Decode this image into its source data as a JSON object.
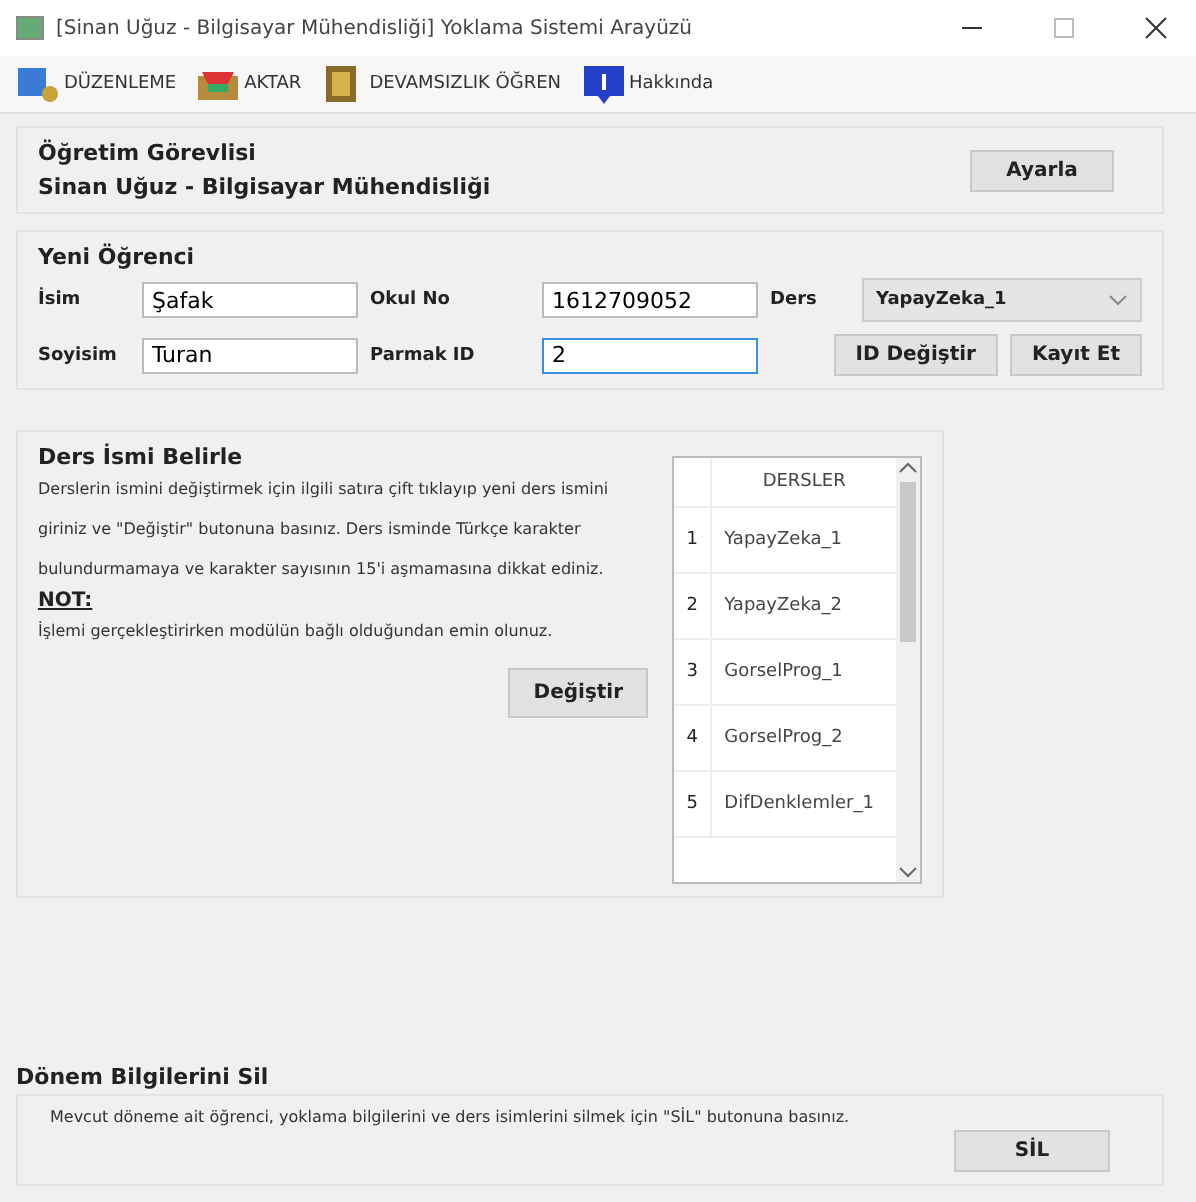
{
  "window": {
    "title": "[Sinan Uğuz - Bilgisayar Mühendisliği] Yoklama Sistemi Arayüzü"
  },
  "toolbar": [
    {
      "label": "DÜZENLEME",
      "kind": "edit"
    },
    {
      "label": "AKTAR",
      "kind": "transfer"
    },
    {
      "label": "DEVAMSIZLIK ÖĞREN",
      "kind": "learn"
    },
    {
      "label": "Hakkında",
      "kind": "about"
    }
  ],
  "instructor": {
    "heading": "Öğretim Görevlisi",
    "name": "Sinan Uğuz - Bilgisayar Mühendisliği",
    "button": "Ayarla"
  },
  "new_student": {
    "heading": "Yeni Öğrenci",
    "fields": [
      {
        "label": "İsim",
        "value": "Şafak",
        "focused": false
      },
      {
        "label": "Okul No",
        "value": "1612709052",
        "focused": false
      },
      {
        "label": "Soyisim",
        "value": "Turan",
        "focused": false
      },
      {
        "label": "Parmak ID",
        "value": "2",
        "focused": true
      }
    ],
    "course": {
      "label": "Ders",
      "value": "YapayZeka_1"
    },
    "buttons": [
      "ID Değiştir",
      "Kayıt Et"
    ]
  },
  "course_names": {
    "heading": "Ders İsmi Belirle",
    "description": "Derslerin ismini değiştirmek için ilgili satıra çift tıklayıp yeni ders ismini giriniz ve \"Değiştir\" butonuna basınız. Ders isminde Türkçe karakter bulundurmamaya ve karakter sayısının 15'i aşmamasına dikkat ediniz.",
    "note_heading": "NOT:",
    "note": "İşlemi gerçekleştirirken modülün bağlı olduğundan emin olunuz.",
    "button": "Değiştir",
    "table": {
      "columns": [
        "DERSLER"
      ],
      "rows": [
        {
          "index": "1",
          "name": "YapayZeka_1"
        },
        {
          "index": "2",
          "name": "YapayZeka_2"
        },
        {
          "index": "3",
          "name": "GorselProg_1"
        },
        {
          "index": "4",
          "name": "GorselProg_2"
        },
        {
          "index": "5",
          "name": "DifDenklemler_1"
        }
      ]
    }
  },
  "delete_term": {
    "heading": "Dönem Bilgilerini Sil",
    "text": "Mevcut döneme ait öğrenci, yoklama bilgilerini ve ders isimlerini silmek için \"SİL\" butonuna basınız.",
    "button": "SİL"
  }
}
